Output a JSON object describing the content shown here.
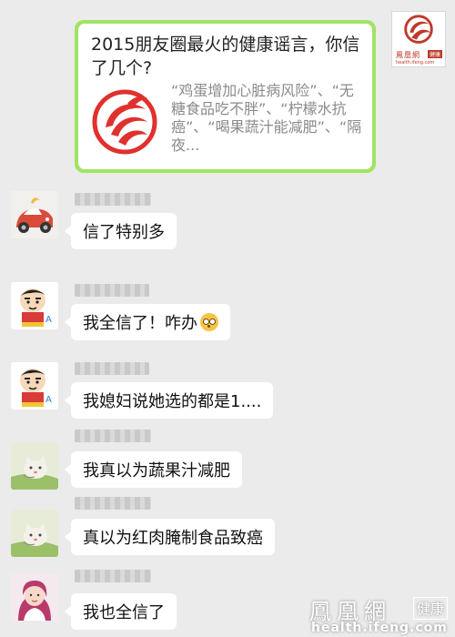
{
  "share_card": {
    "title": "2015朋友圈最火的健康谣言，你信了几个?",
    "description": "“鸡蛋增加心脏病风险”、“无糖食品吃不胖”、“柠檬水抗癌”、“喝果蔬汁能减肥”、“隔夜...",
    "thumb_icon": "ifeng-phoenix-logo",
    "accent_color": "#a0e463",
    "logo_color": "#e0312e"
  },
  "card_avatar": {
    "icon": "ifeng-health-logo",
    "brand": "鳳凰網",
    "tag": "健康",
    "domain": "health.ifeng.com"
  },
  "messages": [
    {
      "text": "信了特别多",
      "avatar": "cartoon-car-avatar"
    },
    {
      "text": "我全信了！咋办",
      "avatar": "crayon-shinchan-avatar",
      "emoji": "flushed-face-emoji"
    },
    {
      "text": "我媳妇说她选的都是1....",
      "avatar": "crayon-shinchan-avatar"
    },
    {
      "text": "我真以为蔬果汁减肥",
      "avatar": "cat-avatar"
    },
    {
      "text": "真以为红肉腌制食品致癌",
      "avatar": "cat-avatar"
    },
    {
      "text": "我也全信了",
      "avatar": "woman-photo-avatar"
    }
  ],
  "watermark": {
    "brand": "鳳凰網",
    "tag": "健康",
    "url": "health.ifeng.com"
  },
  "colors": {
    "chat_background": "#ebebeb",
    "bubble": "#ffffff",
    "brand_red": "#c0392b"
  }
}
